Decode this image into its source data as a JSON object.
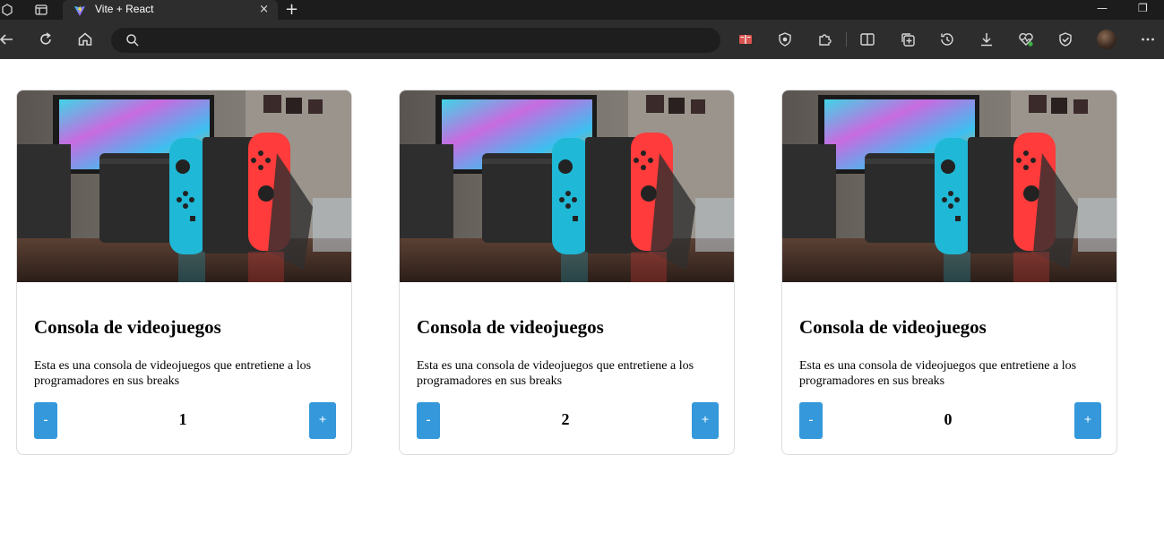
{
  "browser": {
    "tab_title": "Vite + React",
    "tab_close": "×",
    "new_tab": "+",
    "address_text": "",
    "window_minimize": "—",
    "window_restore": "❐"
  },
  "cards": [
    {
      "title": "Consola de videojuegos",
      "description": "Esta es una consola de videojuegos que entretiene a los programadores en sus breaks",
      "minus_label": "-",
      "plus_label": "+",
      "count": "1"
    },
    {
      "title": "Consola de videojuegos",
      "description": "Esta es una consola de videojuegos que entretiene a los programadores en sus breaks",
      "minus_label": "-",
      "plus_label": "+",
      "count": "2"
    },
    {
      "title": "Consola de videojuegos",
      "description": "Esta es una consola de videojuegos que entretiene a los programadores en sus breaks",
      "minus_label": "-",
      "plus_label": "+",
      "count": "0"
    }
  ],
  "colors": {
    "button": "#3498db",
    "joycon_left": "#1fb8d6",
    "joycon_right": "#ff3b3b"
  },
  "icons": [
    "back-icon",
    "reload-icon",
    "home-icon",
    "search-icon",
    "reader-icon",
    "shield-icon",
    "extensions-icon",
    "split-screen-icon",
    "collections-icon",
    "history-icon",
    "download-icon",
    "health-icon",
    "browser-essentials-icon",
    "more-icon"
  ]
}
